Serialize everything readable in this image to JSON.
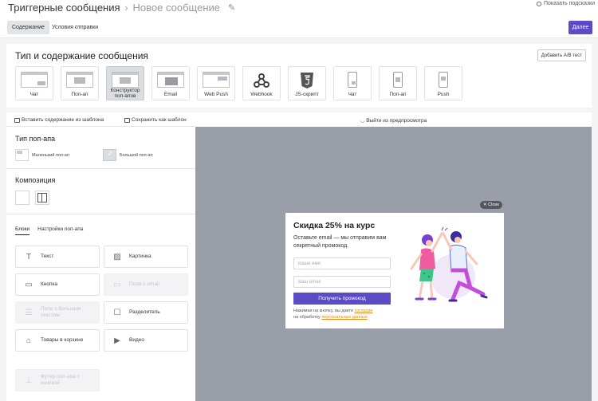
{
  "header": {
    "breadcrumb_root": "Триггерные сообщения",
    "breadcrumb_current": "Новое сообщение",
    "hints_label": "Показать подсказки"
  },
  "tabs": [
    {
      "label": "Содержание"
    },
    {
      "label": "Условия отправки"
    }
  ],
  "next_button": "Далее",
  "type_section": {
    "title": "Тип и содержание сообщения",
    "ab_button": "Добавить A/B тест",
    "cards": [
      {
        "label": "Чат",
        "icon": "desktop-chat-icon"
      },
      {
        "label": "Поп-ап",
        "icon": "desktop-popup-icon"
      },
      {
        "label": "Конструктор поп-апов",
        "icon": "popup-builder-icon"
      },
      {
        "label": "Email",
        "icon": "email-icon"
      },
      {
        "label": "Web Push",
        "icon": "web-push-icon"
      },
      {
        "label": "Webhook",
        "icon": "webhook-icon"
      },
      {
        "label": "JS-скрипт",
        "icon": "html5-icon"
      },
      {
        "label": "Чат",
        "icon": "mobile-chat-icon"
      },
      {
        "label": "Поп-ап",
        "icon": "mobile-popup-icon"
      },
      {
        "label": "Push",
        "icon": "mobile-push-icon"
      }
    ]
  },
  "left_panel": {
    "insert_template": "Вставить содержание из шаблона",
    "save_template": "Сохранить как шаблон",
    "popup_type_title": "Тип поп-апа",
    "popup_small": "Маленький поп-ап",
    "popup_big": "Большой поп-ап",
    "composition_title": "Композиция",
    "tab_blocks": "Блоки",
    "tab_settings": "Настройки поп-апа",
    "blocks": [
      {
        "label": "Текст",
        "icon": "text-icon",
        "disabled": false
      },
      {
        "label": "Картинка",
        "icon": "image-icon",
        "disabled": false
      },
      {
        "label": "Кнопка",
        "icon": "button-icon",
        "disabled": false
      },
      {
        "label": "Поле с email",
        "icon": "email-field-icon",
        "disabled": true
      },
      {
        "label": "Поле с большим текстом",
        "icon": "textarea-icon",
        "disabled": true
      },
      {
        "label": "Разделитель",
        "icon": "divider-icon",
        "disabled": false
      },
      {
        "label": "Товары в корзине",
        "icon": "cart-icon",
        "disabled": false
      },
      {
        "label": "Видео",
        "icon": "video-icon",
        "disabled": false
      },
      {
        "label": "Футер поп-апа с кнопкой",
        "icon": "footer-icon",
        "disabled": true
      }
    ]
  },
  "preview": {
    "exit_label": "Выйти из предпросмотра",
    "close_label": "Close",
    "popup": {
      "title": "Скидка 25% на курс",
      "description": "Оставьте email — мы отправим вам секретный промокод.",
      "name_placeholder": "Ваше имя",
      "email_placeholder": "Ваш email",
      "button": "Получить промокод",
      "note_prefix": "Нажимая на кнопку, вы даете",
      "note_link1": "согласие",
      "note_middle": "на обработку",
      "note_link2": "персональных данных"
    }
  },
  "colors": {
    "accent": "#5b4bc4",
    "preview_bg": "#9a9ea8",
    "link": "#e08a1a"
  }
}
